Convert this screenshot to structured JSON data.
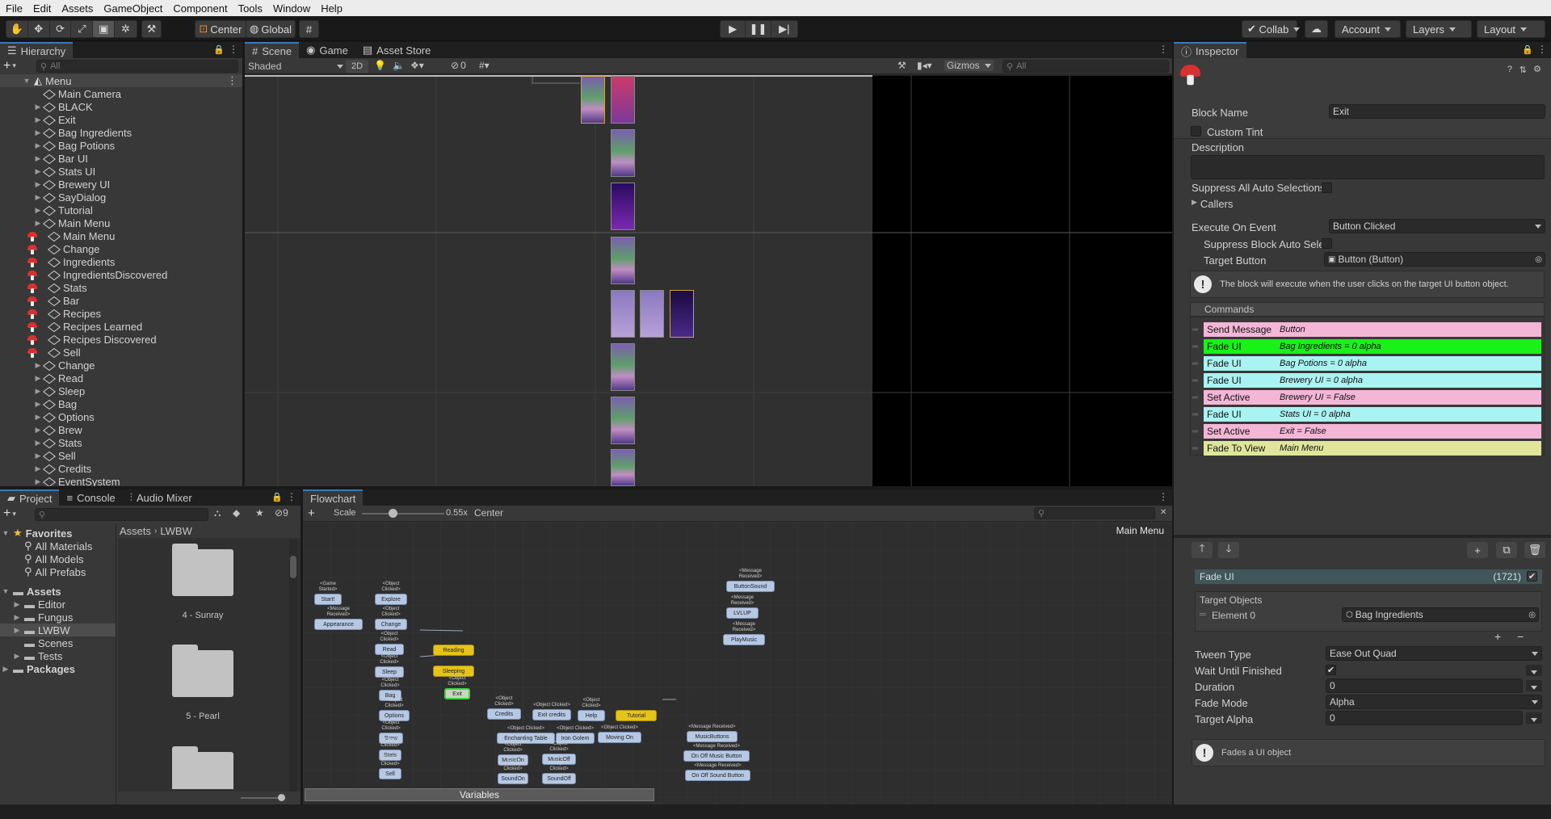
{
  "menu": [
    "File",
    "Edit",
    "Assets",
    "GameObject",
    "Component",
    "Tools",
    "Window",
    "Help"
  ],
  "toolbar": {
    "pivot": "Center",
    "space": "Global",
    "collab": "Collab",
    "account": "Account",
    "layers": "Layers",
    "layout": "Layout"
  },
  "hierarchy": {
    "tab": "Hierarchy",
    "search_placeholder": "All",
    "scene": "Menu",
    "items": [
      {
        "label": "Main Camera",
        "icon": "gameobject"
      },
      {
        "label": "BLACK",
        "icon": "gameobject"
      },
      {
        "label": "Exit",
        "icon": "gameobject"
      },
      {
        "label": "Bag Ingredients",
        "icon": "gameobject"
      },
      {
        "label": "Bag Potions",
        "icon": "gameobject"
      },
      {
        "label": "Bar UI",
        "icon": "gameobject"
      },
      {
        "label": "Stats UI",
        "icon": "gameobject"
      },
      {
        "label": "Brewery UI",
        "icon": "gameobject"
      },
      {
        "label": "SayDialog",
        "icon": "gameobject"
      },
      {
        "label": "Tutorial",
        "icon": "gameobject"
      },
      {
        "label": "Main Menu",
        "icon": "gameobject"
      },
      {
        "label": "Main Menu",
        "icon": "flowchart"
      },
      {
        "label": "Change",
        "icon": "flowchart"
      },
      {
        "label": "Ingredients",
        "icon": "flowchart"
      },
      {
        "label": "IngredientsDiscovered",
        "icon": "flowchart"
      },
      {
        "label": "Stats",
        "icon": "flowchart"
      },
      {
        "label": "Bar",
        "icon": "flowchart"
      },
      {
        "label": "Recipes",
        "icon": "flowchart"
      },
      {
        "label": "Recipes Learned",
        "icon": "flowchart"
      },
      {
        "label": "Recipes Discovered",
        "icon": "flowchart"
      },
      {
        "label": "Sell",
        "icon": "flowchart"
      },
      {
        "label": "Change",
        "icon": "gameobject"
      },
      {
        "label": "Read",
        "icon": "gameobject"
      },
      {
        "label": "Sleep",
        "icon": "gameobject"
      },
      {
        "label": "Bag",
        "icon": "gameobject"
      },
      {
        "label": "Options",
        "icon": "gameobject"
      },
      {
        "label": "Brew",
        "icon": "gameobject"
      },
      {
        "label": "Stats",
        "icon": "gameobject"
      },
      {
        "label": "Sell",
        "icon": "gameobject"
      },
      {
        "label": "Credits",
        "icon": "gameobject"
      },
      {
        "label": "EventSystem",
        "icon": "gameobject"
      }
    ]
  },
  "scene_view": {
    "tabs": [
      "Scene",
      "Game",
      "Asset Store"
    ],
    "shading": "Shaded",
    "mode_2d": "2D",
    "hidden_count": "0",
    "gizmos": "Gizmos",
    "search_placeholder": "All"
  },
  "project": {
    "tabs": [
      "Project",
      "Console",
      "Audio Mixer"
    ],
    "hidden_count": "9",
    "favorites_label": "Favorites",
    "favorites": [
      "All Materials",
      "All Models",
      "All Prefabs"
    ],
    "assets_label": "Assets",
    "folders": [
      "Editor",
      "Fungus",
      "LWBW",
      "Scenes",
      "Tests"
    ],
    "packages_label": "Packages",
    "breadcrumb": [
      "Assets",
      "LWBW"
    ],
    "grid_items": [
      "4 - Sunray",
      "5 - Pearl"
    ]
  },
  "flowchart": {
    "tab": "Flowchart",
    "scale_label": "Scale",
    "scale_value": "0.55x",
    "center_label": "Center",
    "title": "Main Menu",
    "variables_label": "Variables",
    "blocks": [
      {
        "ev": "<Game\nStarted>",
        "label": "Start!",
        "yellow": false
      },
      {
        "ev": "<Message\nReceived>",
        "label": "Appearance",
        "yellow": false
      },
      {
        "ev": "<Object\nClicked>",
        "label": "Explore",
        "yellow": false
      },
      {
        "ev": "<Object\nClicked>",
        "label": "Change",
        "yellow": false
      },
      {
        "ev": "<Object\nClicked>",
        "label": "Read",
        "yellow": false
      },
      {
        "ev": "<Object\nClicked>",
        "label": "Sleep",
        "yellow": false
      },
      {
        "ev": "<Object\nClicked>",
        "label": "Bag",
        "yellow": false
      },
      {
        "ev": "<Object\nClicked>",
        "label": "Options",
        "yellow": false
      },
      {
        "ev": "<Object\nClicked>",
        "label": "Brew",
        "yellow": false
      },
      {
        "ev": "<Object\nClicked>",
        "label": "Stats",
        "yellow": false
      },
      {
        "ev": "<Object\nClicked>",
        "label": "Sell",
        "yellow": false
      },
      {
        "ev": "",
        "label": "Reading",
        "yellow": true
      },
      {
        "ev": "",
        "label": "Sleeping",
        "yellow": true
      },
      {
        "ev": "<Object\nClicked>",
        "label": "Exit",
        "yellow": false
      },
      {
        "ev": "<Object\nClicked>",
        "label": "Credits",
        "yellow": false
      },
      {
        "ev": "<Object Clicked>",
        "label": "Exit credits",
        "yellow": false
      },
      {
        "ev": "<Object\nClicked>",
        "label": "Help",
        "yellow": false
      },
      {
        "ev": "",
        "label": "Tutorial",
        "yellow": true
      },
      {
        "ev": "<Object Clicked>",
        "label": "Enchanting Table",
        "yellow": false
      },
      {
        "ev": "<Object Clicked>",
        "label": "Iron Golem",
        "yellow": false
      },
      {
        "ev": "<Object Clicked>",
        "label": "Moving On",
        "yellow": false
      },
      {
        "ev": "<Object\nClicked>",
        "label": "MusicOn",
        "yellow": false
      },
      {
        "ev": "<Object\nClicked>",
        "label": "MusicOff",
        "yellow": false
      },
      {
        "ev": "<Object\nClicked>",
        "label": "SoundOn",
        "yellow": false
      },
      {
        "ev": "<Object\nClicked>",
        "label": "SoundOff",
        "yellow": false
      },
      {
        "ev": "<Message\nReceived>",
        "label": "ButtonSound",
        "yellow": false
      },
      {
        "ev": "<Message\nReceived>",
        "label": "LVLUP",
        "yellow": false
      },
      {
        "ev": "<Message\nReceived>",
        "label": "PlayMusic",
        "yellow": false
      },
      {
        "ev": "<Message Received>",
        "label": "MusicButtons",
        "yellow": false
      },
      {
        "ev": "<Message Received>",
        "label": "On Off Music Button",
        "yellow": false
      },
      {
        "ev": "<Message Received>",
        "label": "On Off Sound Button",
        "yellow": false
      }
    ]
  },
  "inspector": {
    "tab": "Inspector",
    "block_name_label": "Block Name",
    "block_name": "Exit",
    "custom_tint": "Custom Tint",
    "description": "Description",
    "suppress_all": "Suppress All Auto Selections",
    "callers": "Callers",
    "execute_label": "Execute On Event",
    "execute_value": "Button Clicked",
    "suppress_block": "Suppress Block Auto Sele",
    "target_button_label": "Target Button",
    "target_button_value": "Button (Button)",
    "info": "The block will execute when the user clicks on the target UI button object.",
    "commands_label": "Commands",
    "commands": [
      {
        "name": "Send Message",
        "summary": "Button",
        "color": "#f3b6d6"
      },
      {
        "name": "Fade UI",
        "summary": "Bag Ingredients = 0 alpha",
        "color": "#19f119"
      },
      {
        "name": "Fade UI",
        "summary": "Bag Potions = 0 alpha",
        "color": "#a9f3f2"
      },
      {
        "name": "Fade UI",
        "summary": "Brewery UI = 0 alpha",
        "color": "#a9f3f2"
      },
      {
        "name": "Set Active",
        "summary": "Brewery UI = False",
        "color": "#f3b6d6"
      },
      {
        "name": "Fade UI",
        "summary": "Stats UI = 0 alpha",
        "color": "#a9f3f2"
      },
      {
        "name": "Set Active",
        "summary": "Exit = False",
        "color": "#f3b6d6"
      },
      {
        "name": "Fade To View",
        "summary": "Main Menu",
        "color": "#dfe59a"
      }
    ],
    "selected_command": "Fade UI",
    "selected_index": "(1721)",
    "target_objects": "Target Objects",
    "element_label": "Element 0",
    "element_value": "Bag Ingredients",
    "tween_label": "Tween Type",
    "tween_value": "Ease Out Quad",
    "wait_label": "Wait Until Finished",
    "duration_label": "Duration",
    "duration_value": "0",
    "fade_mode_label": "Fade Mode",
    "fade_mode_value": "Alpha",
    "target_alpha_label": "Target Alpha",
    "target_alpha_value": "0",
    "help": "Fades a UI object"
  },
  "colors": {
    "accent": "#3a79bb",
    "flowchart_node": "#b6c8e4",
    "yellow_block": "#e6c319"
  }
}
